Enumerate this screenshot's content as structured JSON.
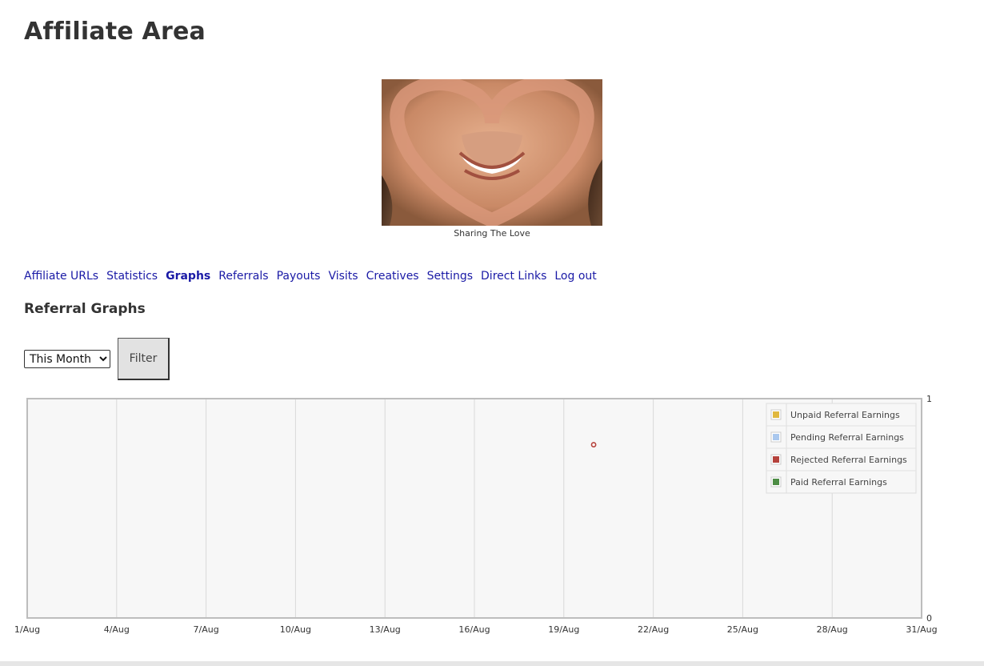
{
  "page": {
    "title": "Affiliate Area"
  },
  "hero": {
    "caption": "Sharing The Love"
  },
  "tabs": [
    {
      "label": "Affiliate URLs",
      "active": false
    },
    {
      "label": "Statistics",
      "active": false
    },
    {
      "label": "Graphs",
      "active": true
    },
    {
      "label": "Referrals",
      "active": false
    },
    {
      "label": "Payouts",
      "active": false
    },
    {
      "label": "Visits",
      "active": false
    },
    {
      "label": "Creatives",
      "active": false
    },
    {
      "label": "Settings",
      "active": false
    },
    {
      "label": "Direct Links",
      "active": false
    },
    {
      "label": "Log out",
      "active": false
    }
  ],
  "section": {
    "title": "Referral Graphs"
  },
  "filter": {
    "selected": "This Month",
    "options": [
      "This Month"
    ],
    "button_label": "Filter"
  },
  "chart_data": {
    "type": "line",
    "x_tick_labels": [
      "1/Aug",
      "4/Aug",
      "7/Aug",
      "10/Aug",
      "13/Aug",
      "16/Aug",
      "19/Aug",
      "22/Aug",
      "25/Aug",
      "28/Aug",
      "31/Aug"
    ],
    "x_range": [
      1,
      31
    ],
    "y_range": [
      0,
      1
    ],
    "y_tick_labels": [
      "1",
      "0"
    ],
    "grid": true,
    "legend_placement": "top-right",
    "series": [
      {
        "name": "Unpaid Referral Earnings",
        "color": "#e0b840",
        "points": []
      },
      {
        "name": "Pending Referral Earnings",
        "color": "#aac8ee",
        "points": []
      },
      {
        "name": "Rejected Referral Earnings",
        "color": "#b5423c",
        "points": [
          {
            "x": 20,
            "y": 0.79
          }
        ]
      },
      {
        "name": "Paid Referral Earnings",
        "color": "#4d8d45",
        "points": []
      }
    ]
  }
}
